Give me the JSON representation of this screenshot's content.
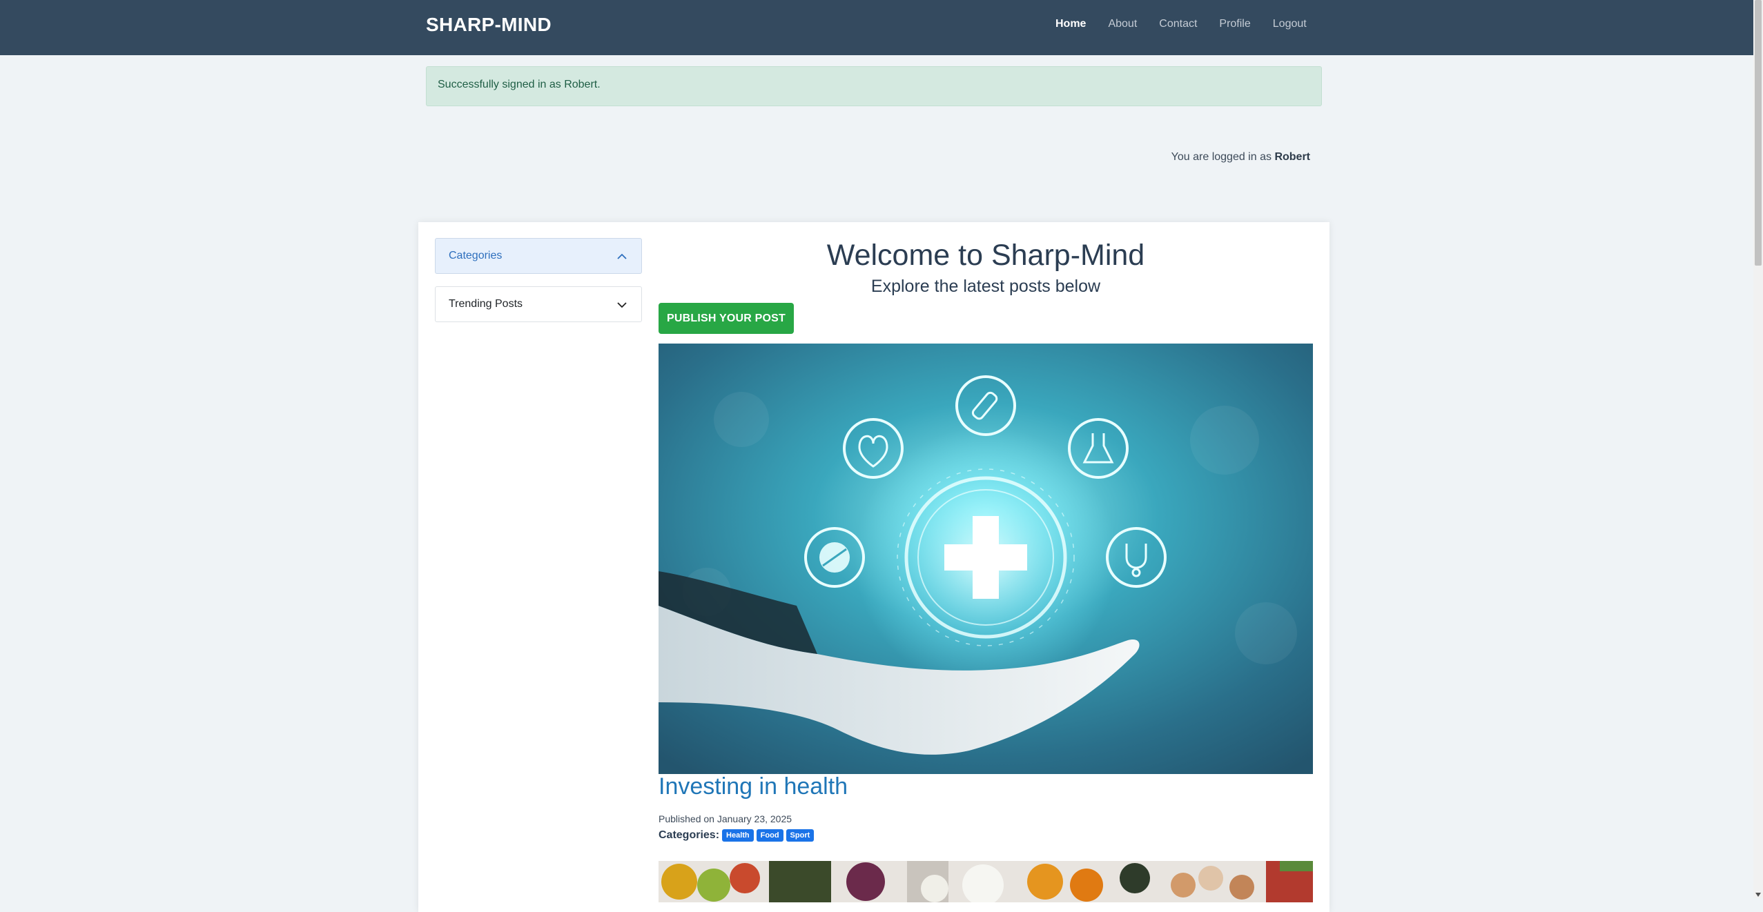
{
  "navbar": {
    "brand": "SHARP-MIND",
    "links": [
      "Home",
      "About",
      "Contact",
      "Profile",
      "Logout"
    ],
    "active": "Home"
  },
  "alert": {
    "message": "Successfully signed in as Robert."
  },
  "status": {
    "prefix": "You are logged in as",
    "username": "Robert"
  },
  "sidebar": {
    "items": [
      {
        "label": "Categories",
        "state": "expanded"
      },
      {
        "label": "Trending Posts",
        "state": "collapsed"
      }
    ]
  },
  "main": {
    "title": "Welcome to Sharp-Mind",
    "subtitle": "Explore the latest posts below",
    "publish_button": "PUBLISH YOUR POST"
  },
  "post": {
    "title": "Investing in health",
    "date": "Published on January 23, 2025",
    "categories_label": "Categories:",
    "categories": [
      "Health",
      "Food",
      "Sport"
    ]
  },
  "colors": {
    "navbar": "#344a5f",
    "publish": "#28a745",
    "badge": "#1a73e8",
    "post_title": "#1f76b7"
  }
}
